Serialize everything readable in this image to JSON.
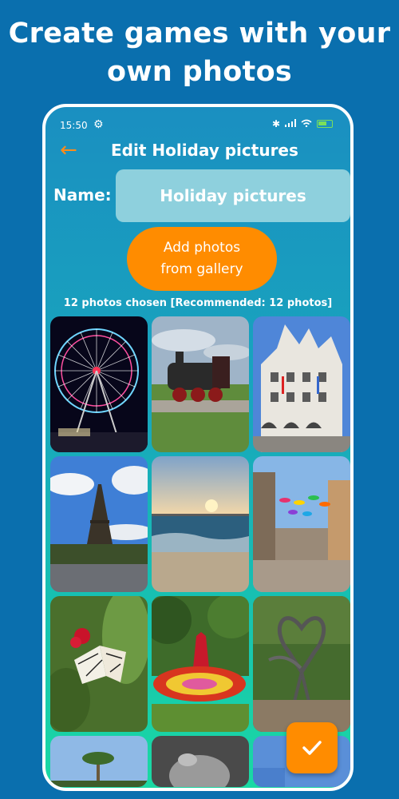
{
  "headline": "Create games with your own photos",
  "status_bar": {
    "time": "15:50",
    "gear_icon": "gear-icon",
    "bluetooth_icon": "bluetooth-icon",
    "signal_icon": "signal-icon",
    "wifi_icon": "wifi-icon",
    "battery_icon": "battery-icon"
  },
  "app_bar": {
    "back_icon": "arrow-left-icon",
    "title": "Edit Holiday pictures"
  },
  "form": {
    "name_label": "Name:",
    "name_value": "Holiday pictures"
  },
  "add_button": {
    "label": "Add photos\nfrom gallery"
  },
  "chosen_text": "12 photos chosen [Recommended: 12 photos]",
  "photos": [
    "ferris-wheel-photo",
    "steam-locomotive-photo",
    "gabled-town-hall-photo",
    "eiffel-tower-photo",
    "sunset-beach-photo",
    "umbrella-street-photo",
    "butterfly-photo",
    "flower-garden-photo",
    "heart-sculpture-photo",
    "palm-tree-photo",
    "cat-photo",
    "sky-photo"
  ],
  "fab": {
    "icon": "checkmark-icon"
  },
  "colors": {
    "background": "#0a6fae",
    "accent": "#ff8c00",
    "gradient_top": "#1a8fc1",
    "gradient_bottom": "#1ad9a3"
  }
}
